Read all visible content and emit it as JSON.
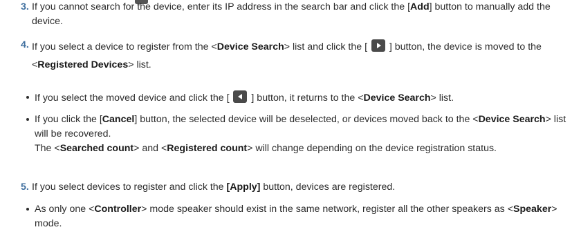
{
  "items": [
    {
      "number": "3.",
      "t1": "If you cannot search for the device, enter its IP address in the search bar and click the [",
      "b1": "Add",
      "t2": "] button to manually add the device."
    },
    {
      "number": "4.",
      "t1": "If you select a device to register from the <",
      "b1": "Device Search",
      "t2": "> list and click the [ ",
      "t3": " ] button, the device is moved to the <",
      "b2": "Registered Devices",
      "t4": "> list."
    },
    {
      "number": "5.",
      "t1": "If you select devices to register and click the ",
      "b1": "[Apply]",
      "t2": " button, devices are registered."
    }
  ],
  "bullets": [
    {
      "t1": "If you select the moved device and click the [ ",
      "t2": " ] button, it returns to the <",
      "b1": "Device Search",
      "t3": "> list."
    },
    {
      "t1": "If you click the [",
      "b1": "Cancel",
      "t2": "] button, the selected device will be deselected, or devices moved back to the <",
      "b2": "Device Search",
      "t3": "> list will be recovered.",
      "t4": "The <",
      "b3": "Searched count",
      "t5": "> and <",
      "b4": "Registered count",
      "t6": "> will change depending on the device registration status."
    },
    {
      "t1": "As only one <",
      "b1": "Controller",
      "t2": "> mode speaker should exist in the same network, register all the other speakers as <",
      "b2": "Speaker",
      "t3": "> mode."
    }
  ],
  "icons": {
    "move_right": "play-right-icon",
    "move_left": "play-left-icon"
  },
  "colors": {
    "number": "#3f6f9f",
    "button_icon": "#4a4a4a"
  }
}
